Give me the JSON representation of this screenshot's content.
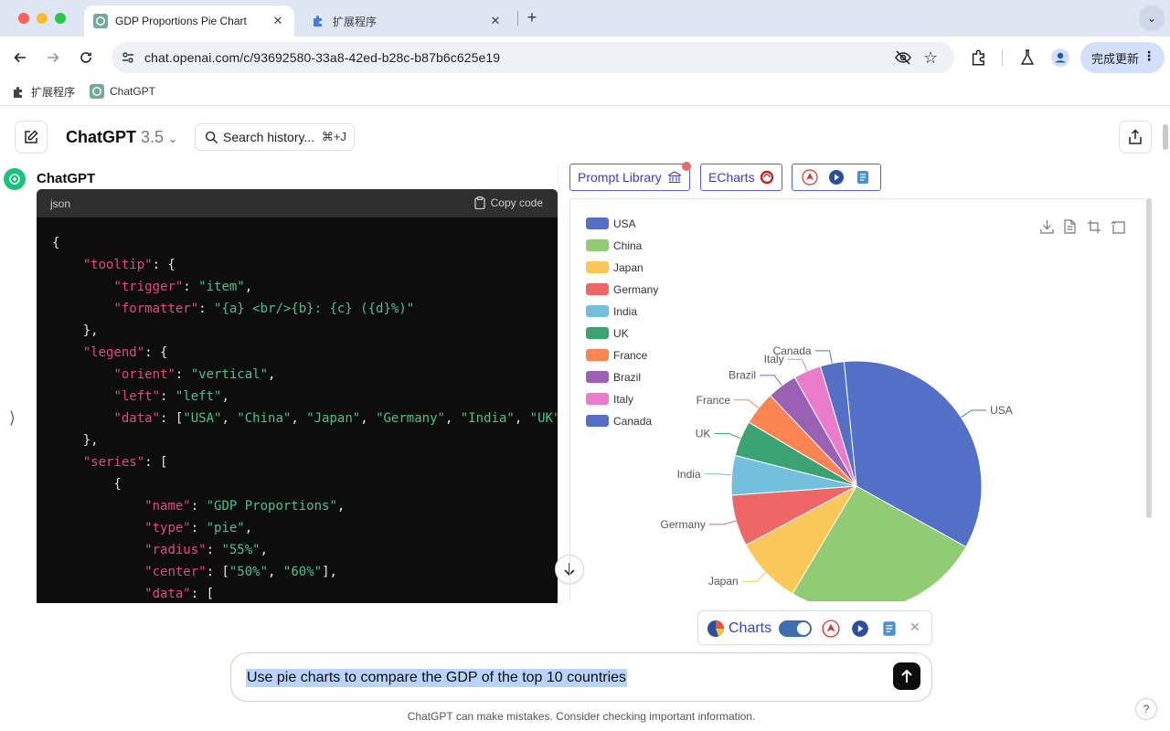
{
  "browser": {
    "tabs": [
      {
        "title": "GDP Proportions Pie Chart",
        "active": true
      },
      {
        "title": "扩展程序",
        "active": false
      }
    ],
    "url": "chat.openai.com/c/93692580-33a8-42ed-b28c-b87b6c625e19",
    "update_label": "完成更新",
    "bookmarks": [
      "扩展程序",
      "ChatGPT"
    ]
  },
  "header": {
    "model_name": "ChatGPT",
    "model_version": "3.5",
    "search_label": "Search history...",
    "search_shortcut": "⌘+J"
  },
  "message": {
    "sender": "ChatGPT",
    "code_lang": "json",
    "copy_label": "Copy code"
  },
  "plugin_buttons": {
    "prompt_library": "Prompt Library",
    "echarts": "ECharts"
  },
  "chart_data": {
    "type": "pie",
    "categories": [
      "USA",
      "China",
      "Japan",
      "Germany",
      "India",
      "UK",
      "France",
      "Brazil",
      "Italy",
      "Canada"
    ],
    "values": [
      34.0,
      25.0,
      8.5,
      6.5,
      5.0,
      4.5,
      4.3,
      3.8,
      3.5,
      3.0
    ],
    "colors": [
      "#5470c6",
      "#91cc75",
      "#fac858",
      "#ee6666",
      "#73c0de",
      "#3ba272",
      "#fc8452",
      "#9a60b4",
      "#ea7ccc",
      "#5470c6"
    ],
    "legend_orient": "vertical",
    "legend_position": "left"
  },
  "bottom": {
    "charts_label": "Charts",
    "composer_text": "Use pie charts to compare the GDP of the top 10 countries",
    "disclaimer": "ChatGPT can make mistakes. Consider checking important information.",
    "help": "?"
  }
}
